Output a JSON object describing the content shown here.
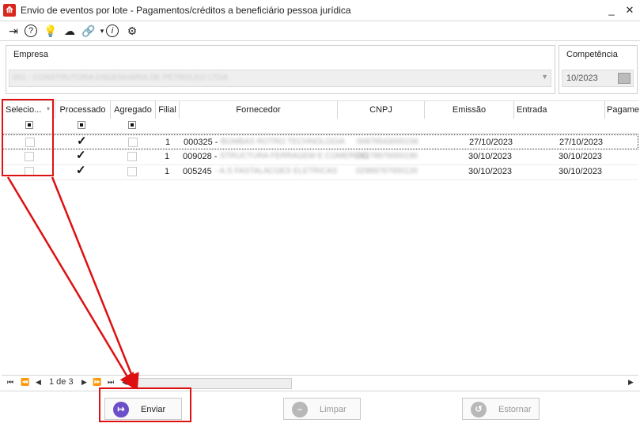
{
  "window": {
    "title": "Envio de eventos por lote - Pagamentos/créditos a beneficiário pessoa jurídica",
    "minimize": "_",
    "close": "✕"
  },
  "toolbar": {
    "icons": [
      "exit-icon",
      "help-icon",
      "bulb-icon",
      "brain-icon",
      "link-icon",
      "info-icon",
      "settings-icon"
    ]
  },
  "empresa": {
    "label": "Empresa",
    "value": "001 - CONSTRUTORA ENGENHARIA DE PETROLEO LTDA"
  },
  "competencia": {
    "label": "Competência",
    "value": "10/2023"
  },
  "grid": {
    "columns": [
      "Selecio...",
      "Processado",
      "Agregado",
      "Filial",
      "Fornecedor",
      "CNPJ",
      "Emissão",
      "Entrada",
      "Pagame"
    ],
    "rows": [
      {
        "filial": "1",
        "fornecedor_code": "000325 -",
        "fornecedor_name": "BOMBAS ROTRO TECHNOLOGIA",
        "cnpj": "00876543000156",
        "emissao": "27/10/2023",
        "entrada": "27/10/2023",
        "processado": "✓"
      },
      {
        "filial": "1",
        "fornecedor_code": "009028 -",
        "fornecedor_name": "STRUCTURA FERRAGEM E COMERCIO",
        "cnpj": "04178976000190",
        "emissao": "30/10/2023",
        "entrada": "30/10/2023",
        "processado": "✓"
      },
      {
        "filial": "1",
        "fornecedor_code": "005245",
        "fornecedor_name": "- A.S FASTALACOES ELETRICAS",
        "cnpj": "02989767000120",
        "emissao": "30/10/2023",
        "entrada": "30/10/2023",
        "processado": "✓"
      }
    ]
  },
  "pager": {
    "text": "1 de 3",
    "first": "⏮",
    "prev_fast": "⏪",
    "prev": "◀",
    "next": "▶",
    "next_fast": "⏩",
    "last": "⏭",
    "scroll_left": "◀",
    "scroll_right": "▶"
  },
  "buttons": {
    "enviar": "Enviar",
    "limpar": "Limpar",
    "estornar": "Estornar"
  },
  "colors": {
    "highlight": "#dd1111",
    "enviar_icon": "#6b4fc9",
    "disabled_icon": "#b8b8b8"
  }
}
